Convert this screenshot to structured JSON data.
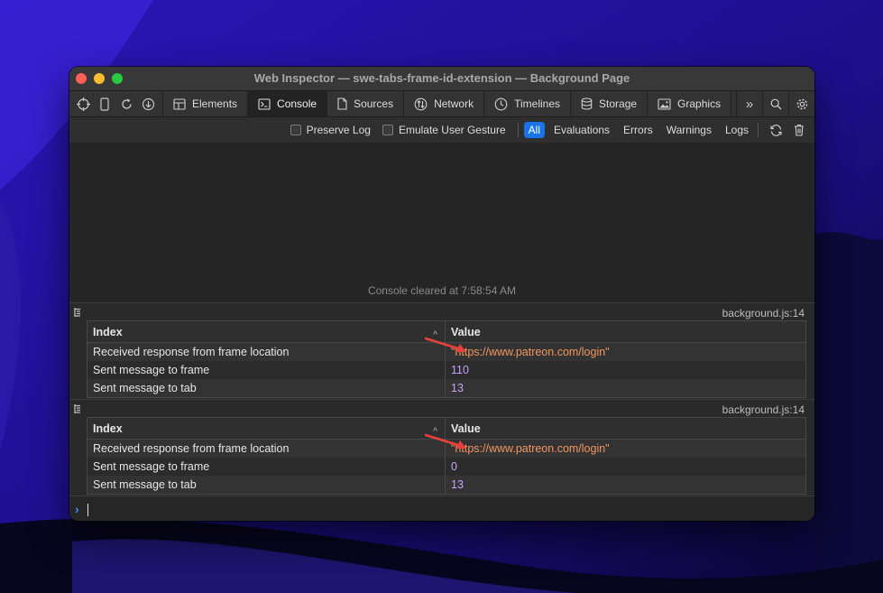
{
  "window": {
    "title": "Web Inspector — swe-tabs-frame-id-extension — Background Page"
  },
  "toolbar": {
    "tools": [
      {
        "name": "crosshair-icon"
      },
      {
        "name": "device-icon"
      },
      {
        "name": "reload-icon"
      },
      {
        "name": "download-icon"
      }
    ],
    "tabs": [
      {
        "label": "Elements",
        "icon": "elements-icon"
      },
      {
        "label": "Console",
        "icon": "console-icon",
        "active": true
      },
      {
        "label": "Sources",
        "icon": "document-icon"
      },
      {
        "label": "Network",
        "icon": "network-icon"
      },
      {
        "label": "Timelines",
        "icon": "clock-icon"
      },
      {
        "label": "Storage",
        "icon": "database-icon"
      },
      {
        "label": "Graphics",
        "icon": "image-icon"
      }
    ],
    "overflow": "»"
  },
  "filters": {
    "preserve_log": "Preserve Log",
    "emulate_user_gesture": "Emulate User Gesture",
    "levels": [
      "All",
      "Evaluations",
      "Errors",
      "Warnings",
      "Logs"
    ],
    "active_level": "All"
  },
  "console": {
    "cleared_text": "Console cleared at 7:58:54 AM",
    "messages": [
      {
        "source": "background.js:14",
        "table": {
          "headers": {
            "index": "Index",
            "value": "Value"
          },
          "rows": [
            {
              "index": "Received response from frame location",
              "value": "\"https://www.patreon.com/login\"",
              "kind": "string"
            },
            {
              "index": "Sent message to frame",
              "value": "110",
              "kind": "number"
            },
            {
              "index": "Sent message to tab",
              "value": "13",
              "kind": "number"
            }
          ]
        }
      },
      {
        "source": "background.js:14",
        "table": {
          "headers": {
            "index": "Index",
            "value": "Value"
          },
          "rows": [
            {
              "index": "Received response from frame location",
              "value": "\"https://www.patreon.com/login\"",
              "kind": "string"
            },
            {
              "index": "Sent message to frame",
              "value": "0",
              "kind": "number"
            },
            {
              "index": "Sent message to tab",
              "value": "13",
              "kind": "number"
            }
          ]
        }
      }
    ]
  },
  "colors": {
    "accent": "#1a73e8",
    "string_value": "#f29760",
    "number_value": "#c6a1ff",
    "annotation_arrow": "#e8403a"
  }
}
